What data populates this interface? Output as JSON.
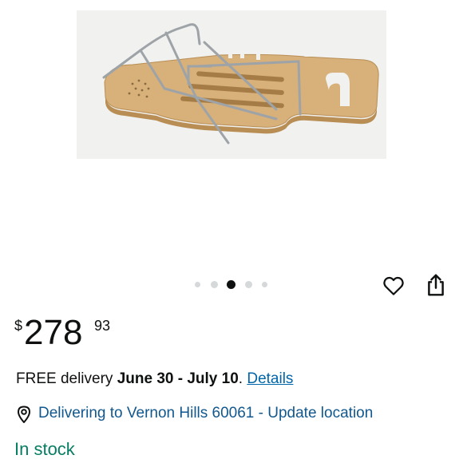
{
  "product": {
    "image_alt_icon": "bamboo-bath-caddy-image"
  },
  "carousel": {
    "total": 5,
    "active_index": 2
  },
  "actions": {
    "wishlist_icon": "heart-outline-icon",
    "share_icon": "share-icon"
  },
  "price": {
    "symbol": "$",
    "whole": "278",
    "fraction": "93"
  },
  "delivery": {
    "prefix": "FREE delivery ",
    "dates": "June 30 - July 10",
    "suffix": ". ",
    "details_link": "Details"
  },
  "location": {
    "icon": "location-pin-icon",
    "text": "Delivering to Vernon Hills 60061 - Update location"
  },
  "stock": {
    "status": "In stock"
  },
  "colors": {
    "link": "#0066a9",
    "location": "#11588f",
    "in_stock": "#067d62",
    "text": "#0f1111"
  }
}
